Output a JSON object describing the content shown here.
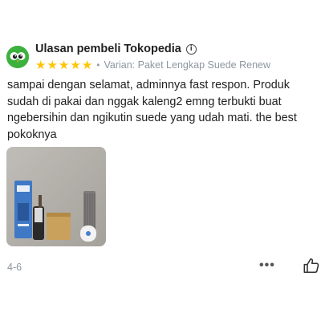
{
  "review": {
    "source_label": "Ulasan pembeli Tokopedia",
    "info_icon": "info-icon",
    "rating": 5,
    "rating_stars": [
      "★",
      "★",
      "★",
      "★",
      "★"
    ],
    "separator": "•",
    "variant_text": "Varian: Paket Lengkap Suede Renew",
    "body": "sampai dengan selamat, adminnya fast respon. Produk sudah di pakai dan nggak kaleng2 emng terbukti buat ngebersihin dan ngikutin suede yang udah mati. the best pokoknya",
    "date": "4-6",
    "more_label": "•••",
    "like_icon": "thumbs-up-icon",
    "avatar_icon": "tokopedia-owl-logo"
  },
  "colors": {
    "star": "#ffc400",
    "avatar_green": "#3db13d",
    "muted_text": "#8d96a0"
  }
}
